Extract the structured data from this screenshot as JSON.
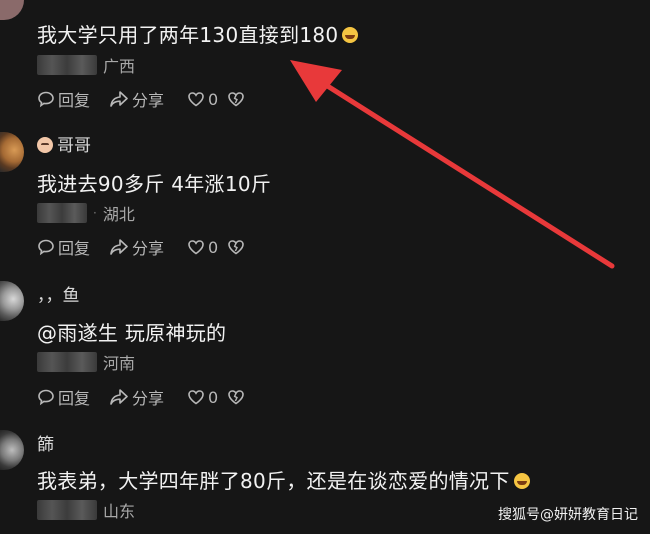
{
  "comments": [
    {
      "username": "",
      "content": "我大学只用了两年130直接到180",
      "location": "广西",
      "actions": {
        "reply": "回复",
        "share": "分享",
        "likes": "0"
      }
    },
    {
      "username": "哥哥",
      "content": "我进去90多斤 4年涨10斤",
      "location": "湖北",
      "actions": {
        "reply": "回复",
        "share": "分享",
        "likes": "0"
      }
    },
    {
      "username": "，，鱼",
      "content": "@雨遂生 玩原神玩的",
      "location": "河南",
      "actions": {
        "reply": "回复",
        "share": "分享",
        "likes": "0"
      }
    },
    {
      "username": "篩",
      "content": "我表弟，大学四年胖了80斤，还是在谈恋爱的情况下",
      "location": "山东"
    }
  ],
  "watermark": "搜狐号@妍妍教育日记",
  "colors": {
    "background": "#161616",
    "arrow": "#e8393a",
    "text": "#f2f2f2",
    "muted": "#a8a8a8"
  },
  "icons": [
    "comment-icon",
    "share-arrow-icon",
    "heart-icon",
    "broken-heart-icon",
    "laugh-cry-emoji"
  ]
}
